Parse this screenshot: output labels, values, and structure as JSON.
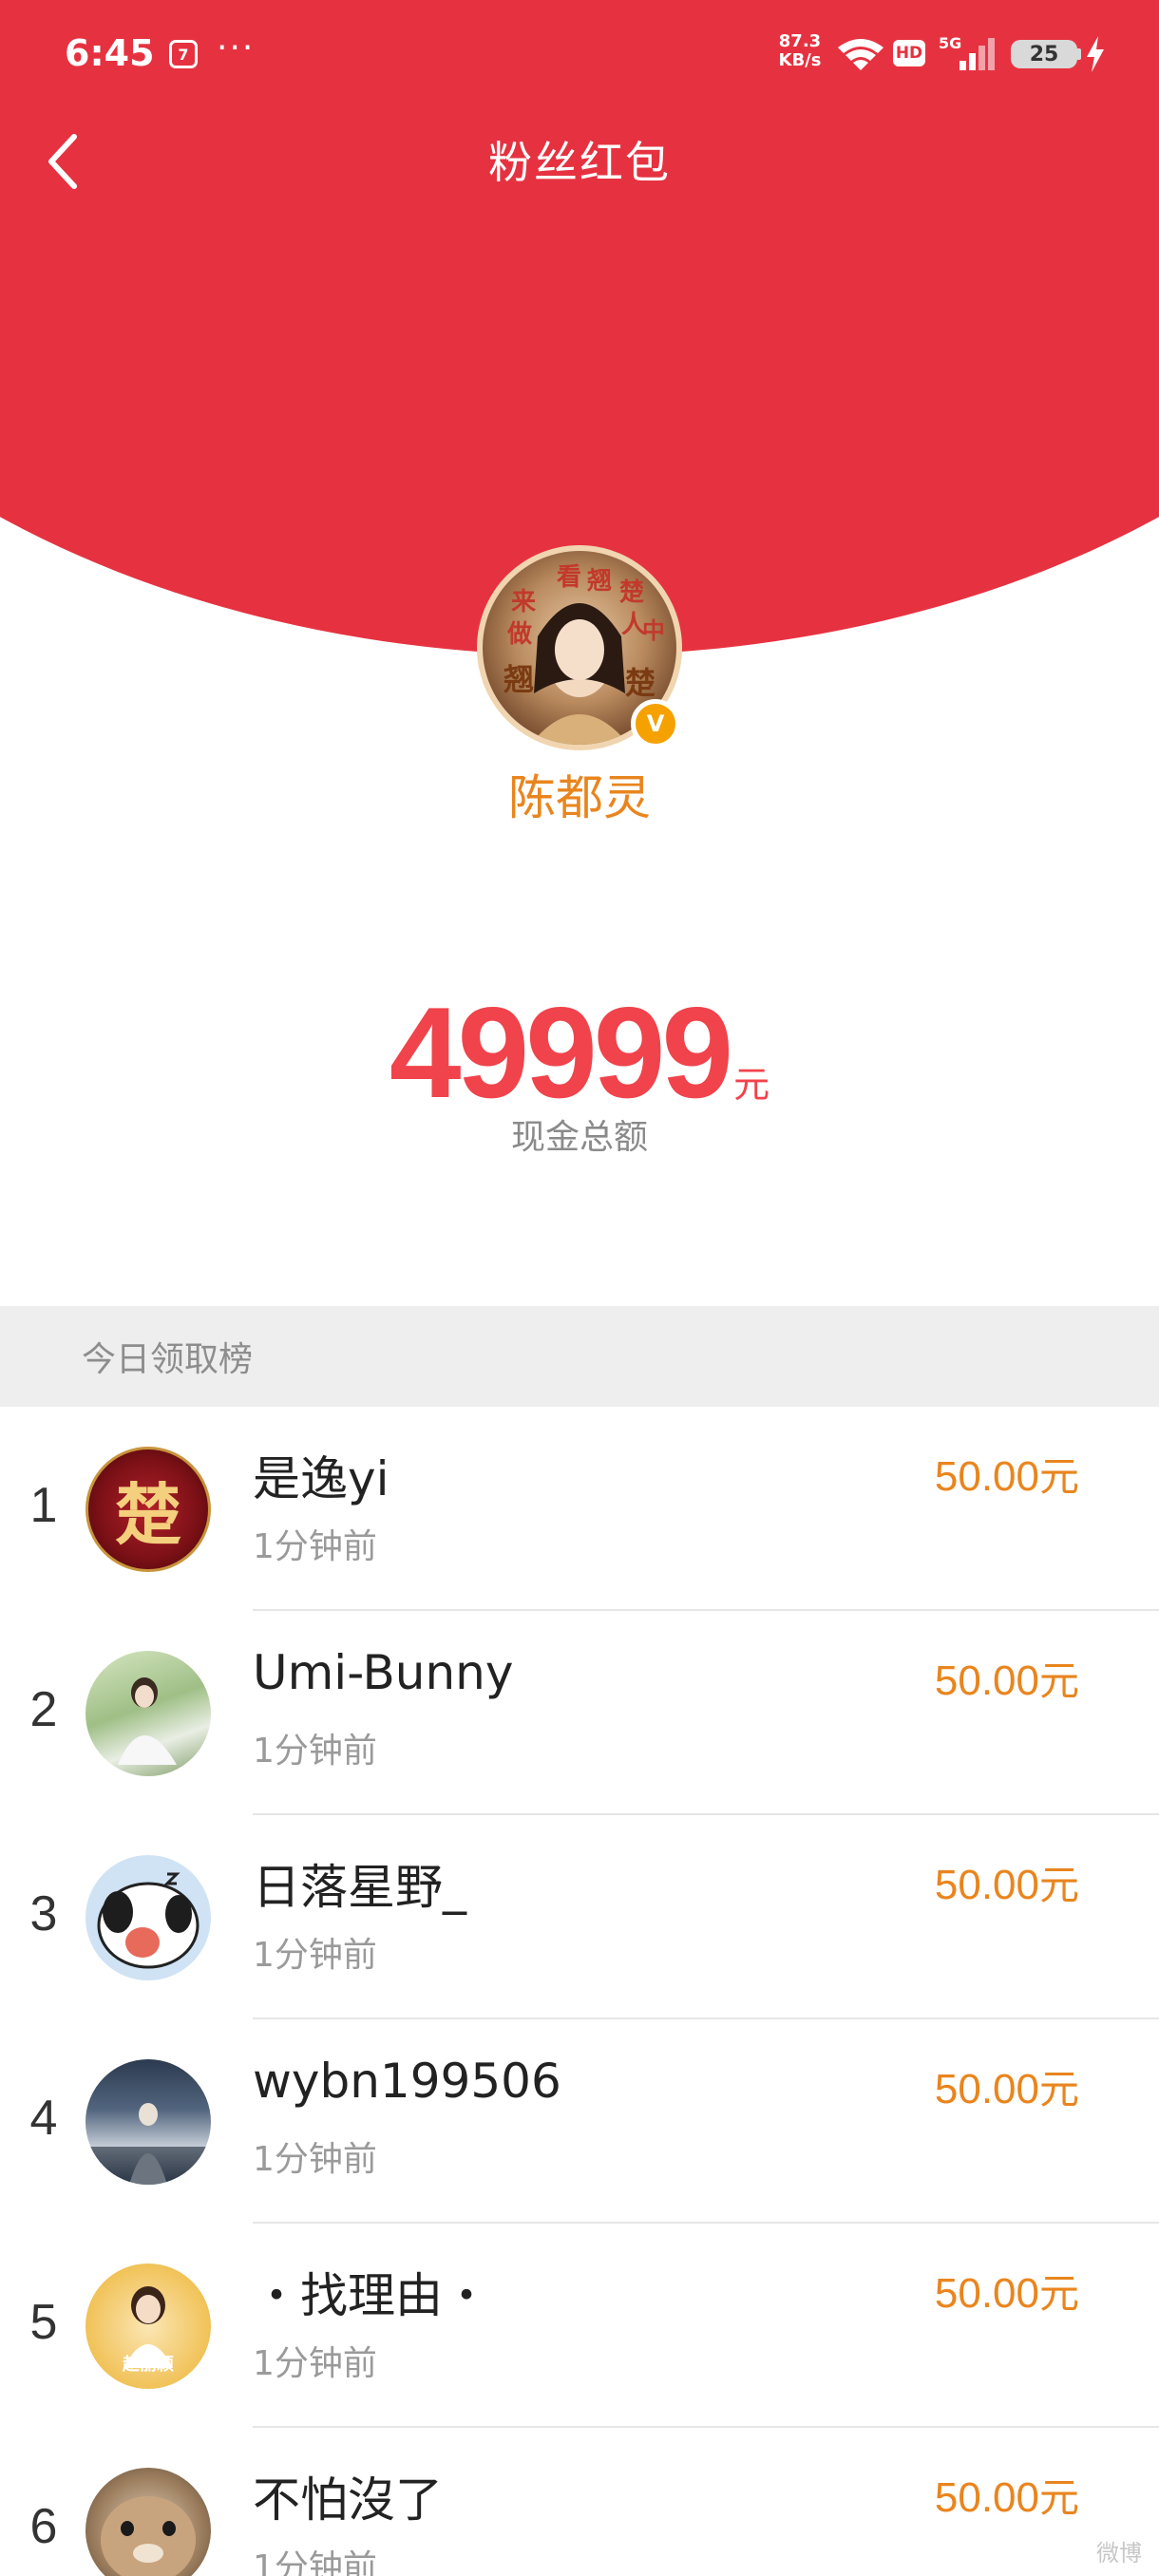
{
  "status_bar": {
    "time": "6:45",
    "app_icon_glyph": "7",
    "more_glyph": "···",
    "net_speed_value": "87.3",
    "net_speed_unit": "KB/s",
    "hd_label": "HD",
    "network_label": "5G",
    "battery_level": "25"
  },
  "nav": {
    "title": "粉丝红包",
    "back_icon": "chevron-left-icon"
  },
  "creator": {
    "name": "陈都灵",
    "verified_mark": "V",
    "avatar_overlay_text": [
      "来",
      "看",
      "翘",
      "楚",
      "做",
      "人",
      "中",
      "翘",
      "楚"
    ]
  },
  "amount": {
    "value": "49999",
    "unit": "元",
    "label": "现金总额"
  },
  "ranking": {
    "header": "今日领取榜",
    "items": [
      {
        "rank": "1",
        "name": "是逸yi",
        "time": "1分钟前",
        "amount": "50.00",
        "unit": "元",
        "avatar_glyph": "楚"
      },
      {
        "rank": "2",
        "name": "Umi-Bunny",
        "time": "1分钟前",
        "amount": "50.00",
        "unit": "元"
      },
      {
        "rank": "3",
        "name": "日落星野_",
        "time": "1分钟前",
        "amount": "50.00",
        "unit": "元"
      },
      {
        "rank": "4",
        "name": "wybn199506",
        "time": "1分钟前",
        "amount": "50.00",
        "unit": "元"
      },
      {
        "rank": "5",
        "name": "・找理由・",
        "time": "1分钟前",
        "amount": "50.00",
        "unit": "元",
        "avatar_text": "赵丽颖"
      },
      {
        "rank": "6",
        "name": "不怕沒了",
        "time": "1分钟前",
        "amount": "50.00",
        "unit": "元"
      }
    ]
  },
  "watermark": "微博"
}
